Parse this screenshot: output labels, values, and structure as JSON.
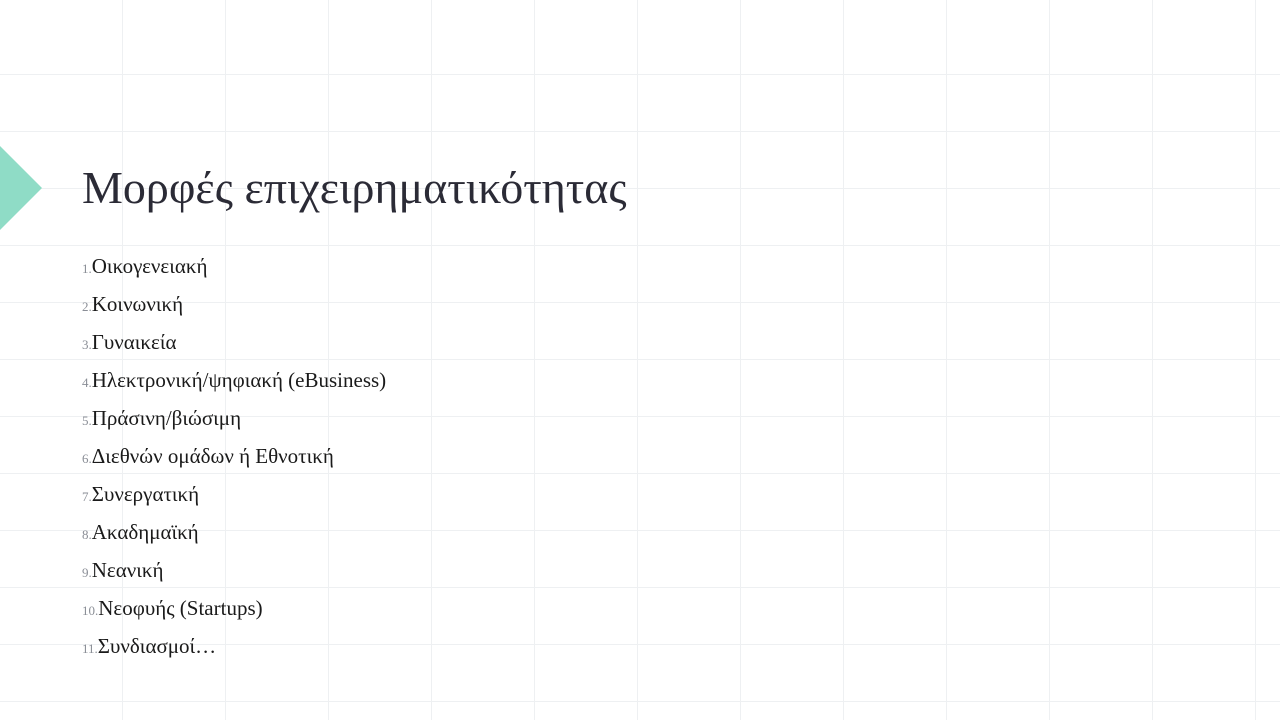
{
  "slide": {
    "title": "Μορφές επιχειρηματικότητας",
    "items": [
      {
        "number": "1.",
        "text": "Οικογενειακή"
      },
      {
        "number": "2.",
        "text": "Κοινωνική"
      },
      {
        "number": "3.",
        "text": "Γυναικεία"
      },
      {
        "number": "4.",
        "text": "Ηλεκτρονική/ψηφιακή (eBusiness)"
      },
      {
        "number": "5.",
        "text": "Πράσινη/βιώσιμη"
      },
      {
        "number": "6.",
        "text": "Διεθνών ομάδων ή Εθνοτική"
      },
      {
        "number": "7.",
        "text": "Συνεργατική"
      },
      {
        "number": "8.",
        "text": "Ακαδημαϊκή"
      },
      {
        "number": "9.",
        "text": "Νεανική"
      },
      {
        "number": "10.",
        "text": "Νεοφυής (Startups)"
      },
      {
        "number": "11.",
        "text": "Συνδιασμοί…"
      }
    ]
  },
  "colors": {
    "accent": "#8fdcc6",
    "title": "#2b2b36",
    "text": "#1a1a1a",
    "number": "#8a8e96",
    "grid": "#eef0f2"
  }
}
